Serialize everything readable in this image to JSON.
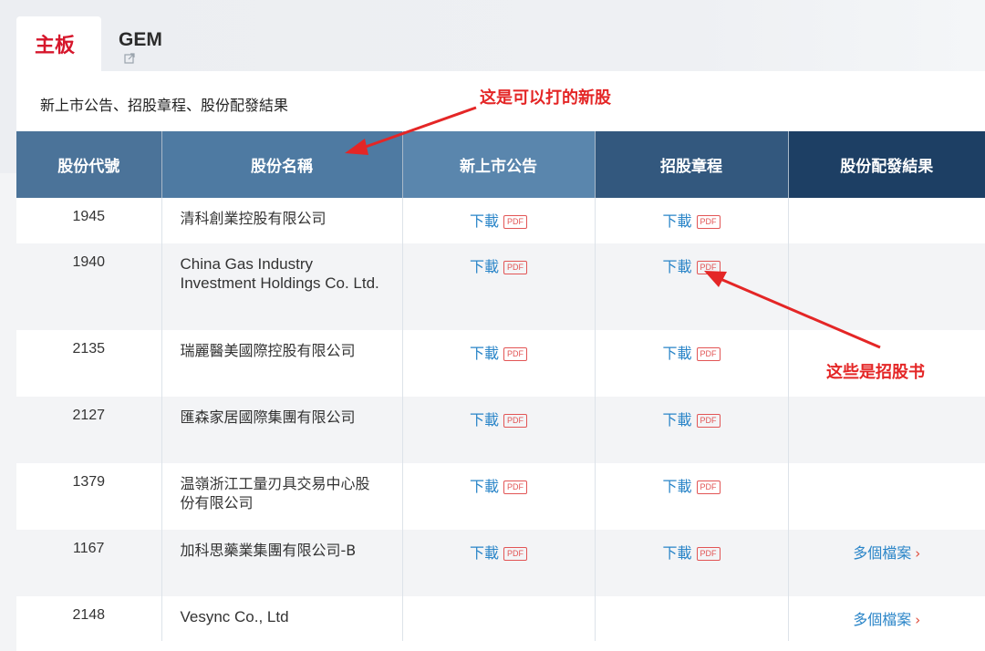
{
  "tabs": {
    "main_board": "主板",
    "gem": "GEM",
    "gem_icon": "external-link-icon"
  },
  "section_title": "新上市公告、招股章程、股份配發結果",
  "table": {
    "headers": [
      "股份代號",
      "股份名稱",
      "新上市公告",
      "招股章程",
      "股份配發結果"
    ],
    "rows": [
      {
        "code": "1945",
        "name": "清科創業控股有限公司",
        "announcement": "下載",
        "prospectus": "下載",
        "allotment": ""
      },
      {
        "code": "1940",
        "name": "China Gas Industry Investment Holdings Co. Ltd.",
        "announcement": "下載",
        "prospectus": "下載",
        "allotment": ""
      },
      {
        "code": "2135",
        "name": "瑞麗醫美國際控股有限公司",
        "announcement": "下載",
        "prospectus": "下載",
        "allotment": ""
      },
      {
        "code": "2127",
        "name": "匯森家居國際集團有限公司",
        "announcement": "下載",
        "prospectus": "下載",
        "allotment": ""
      },
      {
        "code": "1379",
        "name": "温嶺浙江工量刃具交易中心股份有限公司",
        "announcement": "下載",
        "prospectus": "下載",
        "allotment": ""
      },
      {
        "code": "1167",
        "name": "加科思藥業集團有限公司-B",
        "announcement": "下載",
        "prospectus": "下載",
        "allotment": "多個檔案"
      },
      {
        "code": "2148",
        "name": "Vesync Co., Ltd",
        "announcement": "",
        "prospectus": "",
        "allotment": "多個檔案"
      }
    ],
    "pdf_badge": "PDF"
  },
  "annotations": {
    "new_shares_note": "这是可以打的新股",
    "prospectus_note": "这些是招股书",
    "color": "#e42626"
  },
  "colors": {
    "accent_red": "#d6162b",
    "link_blue": "#2a85c8"
  }
}
